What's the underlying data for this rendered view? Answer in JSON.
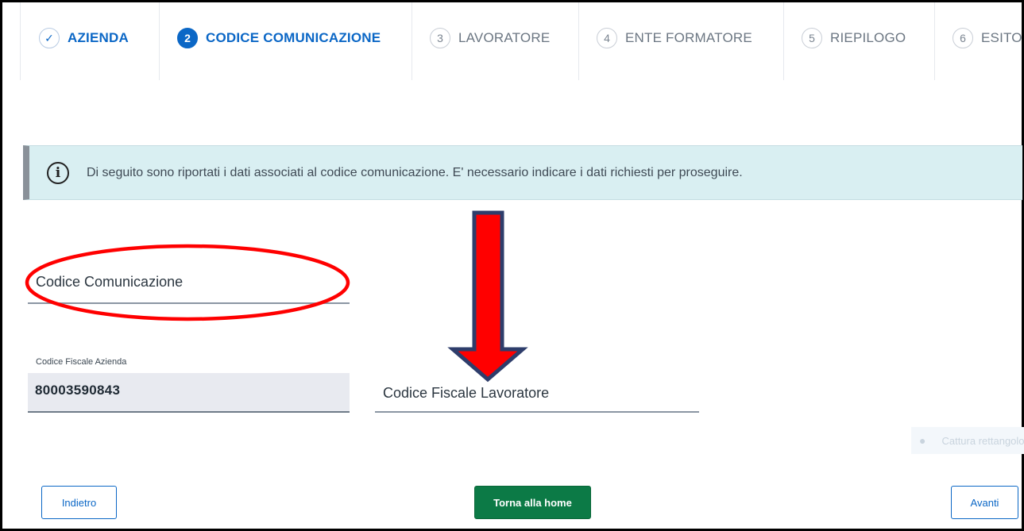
{
  "stepper": {
    "steps": [
      {
        "number": "✓",
        "label": "AZIENDA",
        "state": "done"
      },
      {
        "number": "2",
        "label": "CODICE COMUNICAZIONE",
        "state": "active"
      },
      {
        "number": "3",
        "label": "LAVORATORE",
        "state": "pending"
      },
      {
        "number": "4",
        "label": "ENTE FORMATORE",
        "state": "pending"
      },
      {
        "number": "5",
        "label": "RIEPILOGO",
        "state": "pending"
      },
      {
        "number": "6",
        "label": "ESITO",
        "state": "pending"
      }
    ]
  },
  "info": {
    "icon": "info-icon",
    "glyph": "i",
    "message": "Di seguito sono riportati i dati associati al codice comunicazione. E' necessario indicare i dati richiesti per proseguire."
  },
  "form": {
    "codice_comunicazione": {
      "label": "Codice Comunicazione",
      "value": ""
    },
    "codice_fiscale_azienda": {
      "label": "Codice Fiscale Azienda",
      "value": "80003590843"
    },
    "codice_fiscale_lavoratore": {
      "label": "Codice Fiscale Lavoratore",
      "value": ""
    }
  },
  "faded_widget": {
    "icon": "dot-icon",
    "glyph": "●",
    "label": "Cattura rettangolo"
  },
  "buttons": {
    "back": "Indietro",
    "home": "Torna alla home",
    "next": "Avanti"
  },
  "colors": {
    "accent": "#0b67c6",
    "callout_bg": "#d9eff2",
    "home_button": "#0c7a46",
    "annotation_red": "#ff0000",
    "arrow_outline": "#2e3d6b"
  }
}
